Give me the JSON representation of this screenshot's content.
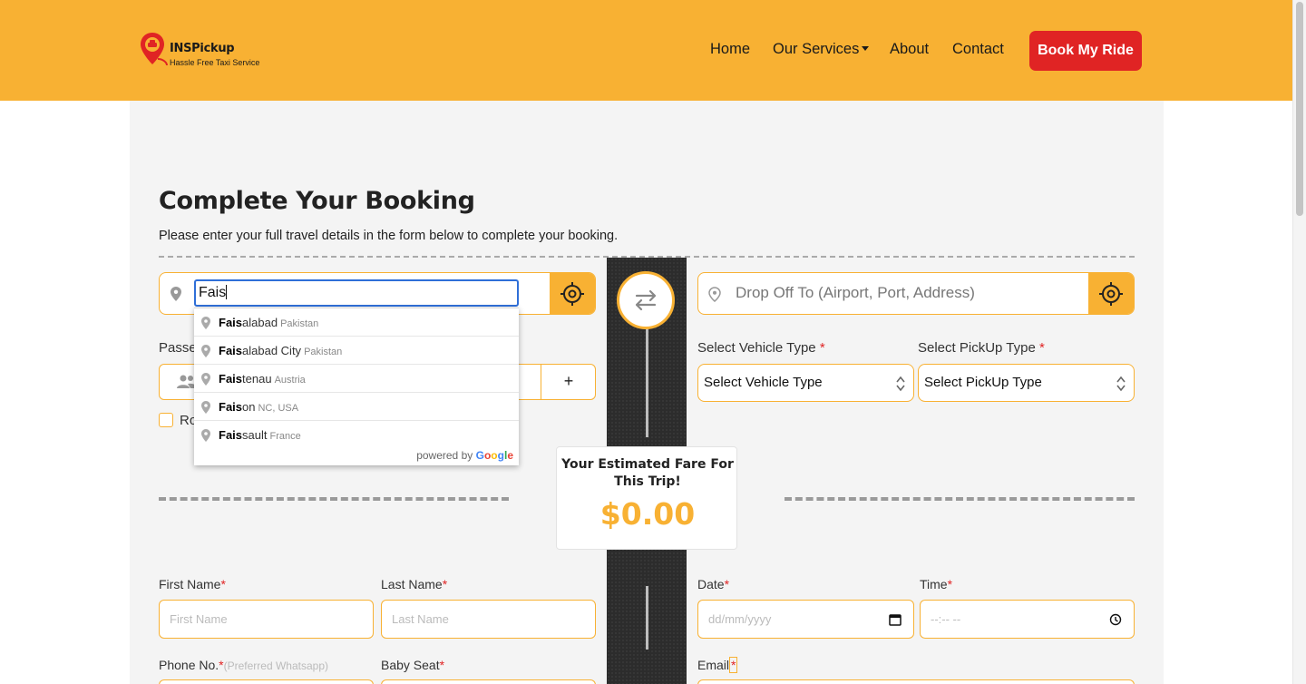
{
  "header": {
    "logo": {
      "name": "INSPickup",
      "tagline": "Hassle Free Taxi Service"
    },
    "nav": [
      {
        "label": "Home"
      },
      {
        "label": "Our Services",
        "has_dropdown": true
      },
      {
        "label": "About"
      },
      {
        "label": "Contact"
      }
    ],
    "cta_label": "Book My Ride"
  },
  "page": {
    "title": "Complete Your Booking",
    "subtitle": "Please enter your full travel details in the form below to complete your booking."
  },
  "pickup": {
    "value": "Fais"
  },
  "dropoff": {
    "placeholder": "Drop Off To (Airport, Port, Address)"
  },
  "autocomplete": {
    "items": [
      {
        "match": "Fais",
        "rest": "alabad",
        "secondary": "Pakistan"
      },
      {
        "match": "Fais",
        "rest": "alabad City",
        "secondary": "Pakistan"
      },
      {
        "match": "Fais",
        "rest": "tenau",
        "secondary": "Austria"
      },
      {
        "match": "Fais",
        "rest": "on",
        "secondary": "NC, USA"
      },
      {
        "match": "Fais",
        "rest": "sault",
        "secondary": "France"
      }
    ],
    "powered_by": "powered by"
  },
  "passengers": {
    "label_partial": "Passe",
    "plus": "+"
  },
  "round_trip": {
    "label_partial": "Ro"
  },
  "vehicle": {
    "label": "Select Vehicle Type",
    "value": "Select Vehicle Type"
  },
  "pickup_type": {
    "label": "Select PickUp Type",
    "value": "Select PickUp Type"
  },
  "fare": {
    "title": "Your Estimated Fare For This Trip!",
    "value": "$0.00"
  },
  "form": {
    "first_name": {
      "label": "First Name",
      "placeholder": "First Name"
    },
    "last_name": {
      "label": "Last Name",
      "placeholder": "Last Name"
    },
    "date": {
      "label": "Date",
      "placeholder": "dd/mm/yyyy"
    },
    "time": {
      "label": "Time",
      "placeholder": "--:-- --"
    },
    "phone": {
      "label": "Phone No.",
      "hint": "(Preferred Whatsapp)"
    },
    "baby_seat": {
      "label": "Baby Seat"
    },
    "email": {
      "label": "Email"
    }
  },
  "colors": {
    "brand": "#f8b133",
    "cta": "#e02424",
    "focus": "#2f6fd8"
  }
}
